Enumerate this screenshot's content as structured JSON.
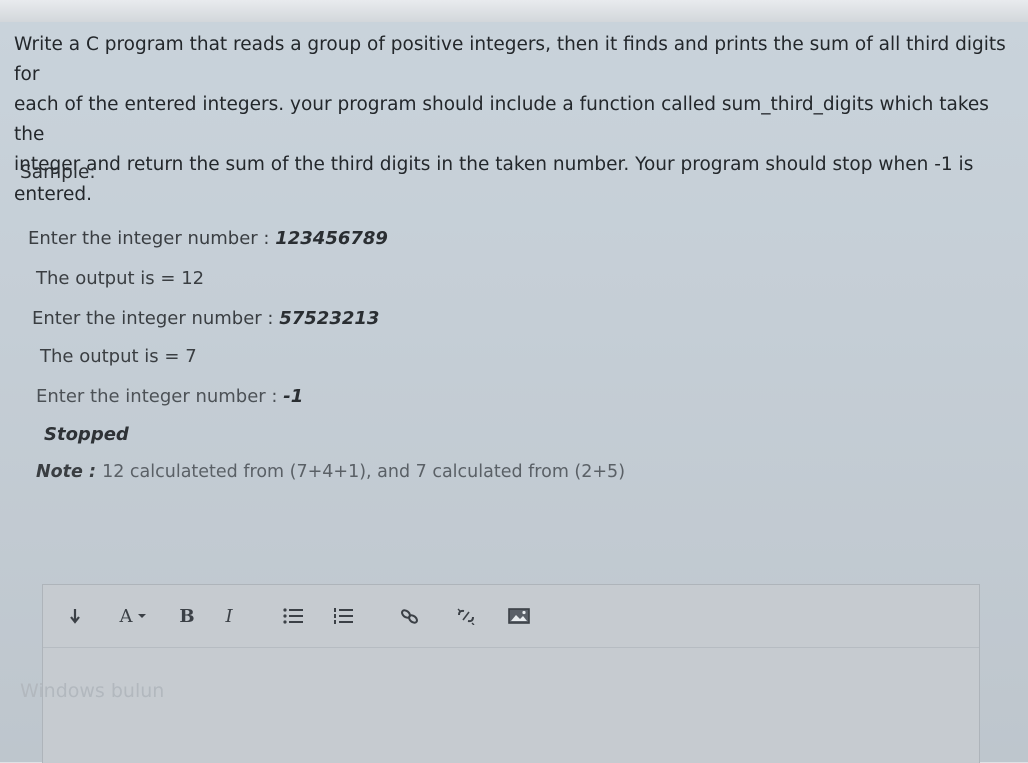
{
  "question": {
    "line1": "Write a C program that reads a group of positive integers, then it finds and prints the sum of all third digits for",
    "line2": "each of the entered integers. your program should include a function called sum_third_digits which takes the",
    "line3": "integer and return the sum of the third digits in the taken number. Your program should stop when -1 is",
    "line4": "entered."
  },
  "sample": {
    "label": "Sample:",
    "lines": [
      {
        "text": "Enter the integer number : ",
        "value": "123456789"
      },
      {
        "text": "The output is = 12",
        "value": ""
      },
      {
        "text": "Enter the integer number : ",
        "value": "57523213"
      },
      {
        "text": "The output is = 7",
        "value": ""
      },
      {
        "text": "Enter the integer number : ",
        "value": "-1"
      }
    ],
    "stopped": "Stopped",
    "note_label": "Note : ",
    "note_text": "12 calculateted from (7+4+1), and  7 calculated from (2+5)"
  },
  "editor": {
    "toolbar": {
      "paragraph_icon": "paragraph-format-icon",
      "font_color_label": "A",
      "font_color_icon": "font-color-icon",
      "bold_label": "B",
      "italic_label": "I",
      "unordered_list_icon": "unordered-list-icon",
      "ordered_list_icon": "ordered-list-icon",
      "link_icon": "link-icon",
      "unlink_icon": "unlink-icon",
      "image_icon": "image-icon"
    },
    "watermark": "Windows bulun"
  }
}
